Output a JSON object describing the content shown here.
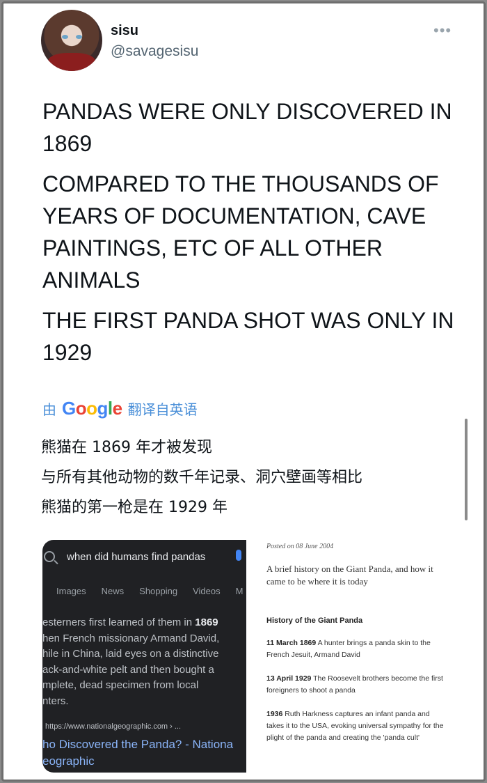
{
  "user": {
    "display_name": "sisu",
    "handle": "@savagesisu",
    "more_label": "•••"
  },
  "tweet": {
    "paragraphs": [
      "PANDAS WERE ONLY DISCOVERED IN 1869",
      "COMPARED TO THE THOUSANDS OF YEARS OF DOCUMENTATION, CAVE PAINTINGS, ETC OF ALL OTHER ANIMALS",
      "THE FIRST PANDA SHOT WAS ONLY IN 1929"
    ]
  },
  "translation": {
    "by_label": "由",
    "google_label": "Google",
    "from_label": "翻译自英语",
    "lines": [
      "熊猫在 1869 年才被发现",
      "与所有其他动物的数千年记录、洞穴壁画等相比",
      "熊猫的第一枪是在 1929 年"
    ]
  },
  "search_screenshot": {
    "query": "when did humans find pandas",
    "tabs": [
      "Images",
      "News",
      "Shopping",
      "Videos",
      "M"
    ],
    "snippet_prefix": "esterners first learned of them in ",
    "snippet_bold": "1869",
    "snippet_rest": "hen French missionary Armand David,\nhile in China, laid eyes on a distinctive\nack-and-white pelt and then bought a\nmplete, dead specimen from local\nnters.",
    "source_url": "https://www.nationalgeographic.com › ...",
    "result_title": "ho Discovered the Panda? - Nationa\neographic"
  },
  "article_screenshot": {
    "posted": "Posted on 08 June 2004",
    "lead": "A brief history on the Giant Panda, and how it came to be where it is today",
    "heading": "History of the Giant Panda",
    "entries": [
      {
        "date": "11 March 1869",
        "text": "A hunter brings a panda skin to the French Jesuit, Armand David"
      },
      {
        "date": "13 April 1929",
        "text": "The Roosevelt brothers become the first foreigners to shoot a panda"
      },
      {
        "date": "1936",
        "text": "Ruth Harkness captures an infant panda and takes it to the USA, evoking universal sympathy for the plight of the panda and creating the 'panda cult'"
      }
    ]
  }
}
